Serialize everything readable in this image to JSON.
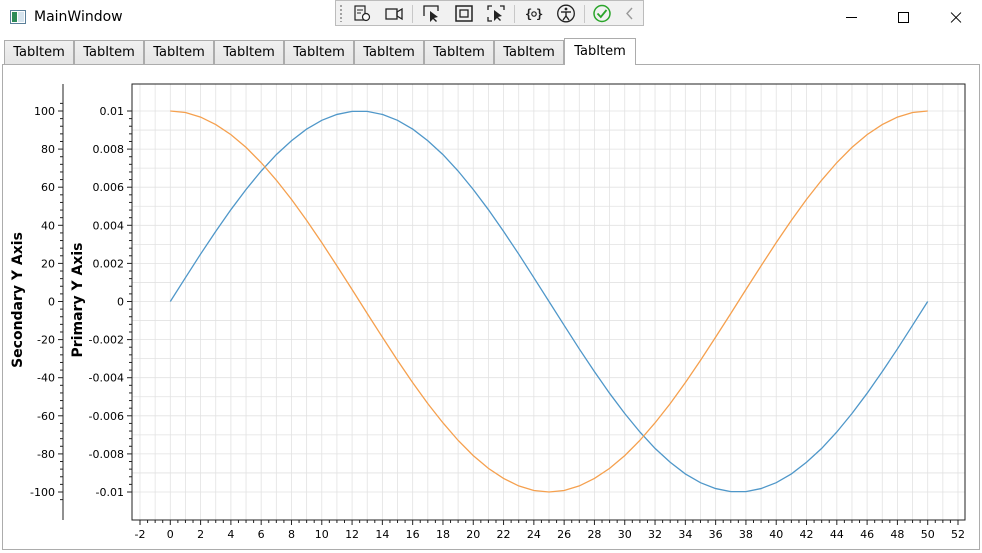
{
  "window": {
    "title": "MainWindow"
  },
  "tabs": [
    "TabItem",
    "TabItem",
    "TabItem",
    "TabItem",
    "TabItem",
    "TabItem",
    "TabItem",
    "TabItem",
    "TabItem"
  ],
  "selected_tab": 8,
  "colors": {
    "series_blue": "#4f97c9",
    "series_orange": "#f5a04e",
    "grid": "#e2e2e2",
    "check_green": "#2aa52a"
  },
  "debug_toolbar": {
    "icons": [
      "live-visual-tree-icon",
      "record-icon",
      "select-element-icon",
      "display-layout-adorners-icon",
      "track-focus-icon",
      "binding-failures-icon",
      "accessibility-icon",
      "checkmark-icon",
      "collapse-icon"
    ]
  },
  "chart_data": {
    "type": "line",
    "xlabel": "",
    "ylabel": "Primary Y Axis",
    "y2label": "Secondary Y Axis",
    "xlim": [
      -2,
      52
    ],
    "ylim": [
      -0.01,
      0.01
    ],
    "y2lim": [
      -100,
      100
    ],
    "grid": true,
    "x_ticks": [
      "-2",
      "0",
      "2",
      "4",
      "6",
      "8",
      "10",
      "12",
      "14",
      "16",
      "18",
      "20",
      "22",
      "24",
      "26",
      "28",
      "30",
      "32",
      "34",
      "36",
      "38",
      "40",
      "42",
      "44",
      "46",
      "48",
      "50",
      "52"
    ],
    "y_ticks": [
      "0.01",
      "0.008",
      "0.006",
      "0.004",
      "0.002",
      "0",
      "-0.002",
      "-0.004",
      "-0.006",
      "-0.008",
      "-0.01"
    ],
    "y2_ticks": [
      "100",
      "80",
      "60",
      "40",
      "20",
      "0",
      "-20",
      "-40",
      "-60",
      "-80",
      "-100"
    ],
    "series": [
      {
        "axis": "primary",
        "color": "#4f97c9",
        "x": [
          0,
          1,
          2,
          3,
          4,
          5,
          6,
          7,
          8,
          9,
          10,
          11,
          12,
          13,
          14,
          15,
          16,
          17,
          18,
          19,
          20,
          21,
          22,
          23,
          24,
          25,
          26,
          27,
          28,
          29,
          30,
          31,
          32,
          33,
          34,
          35,
          36,
          37,
          38,
          39,
          40,
          41,
          42,
          43,
          44,
          45,
          46,
          47,
          48,
          49,
          50
        ],
        "y": [
          0,
          0.00125,
          0.00249,
          0.00368,
          0.00482,
          0.00588,
          0.00685,
          0.00771,
          0.00844,
          0.00905,
          0.00951,
          0.00982,
          0.00998,
          0.00998,
          0.00982,
          0.00951,
          0.00905,
          0.00844,
          0.00771,
          0.00685,
          0.00588,
          0.00482,
          0.00368,
          0.00249,
          0.00125,
          0,
          -0.00125,
          -0.00249,
          -0.00368,
          -0.00482,
          -0.00588,
          -0.00685,
          -0.00771,
          -0.00844,
          -0.00905,
          -0.00951,
          -0.00982,
          -0.00998,
          -0.00998,
          -0.00982,
          -0.00951,
          -0.00905,
          -0.00844,
          -0.00771,
          -0.00685,
          -0.00588,
          -0.00482,
          -0.00368,
          -0.00249,
          -0.00125,
          0
        ]
      },
      {
        "axis": "secondary",
        "color": "#f5a04e",
        "x": [
          0,
          1,
          2,
          3,
          4,
          5,
          6,
          7,
          8,
          9,
          10,
          11,
          12,
          13,
          14,
          15,
          16,
          17,
          18,
          19,
          20,
          21,
          22,
          23,
          24,
          25,
          26,
          27,
          28,
          29,
          30,
          31,
          32,
          33,
          34,
          35,
          36,
          37,
          38,
          39,
          40,
          41,
          42,
          43,
          44,
          45,
          46,
          47,
          48,
          49,
          50
        ],
        "y": [
          100,
          99.2,
          96.8,
          92.9,
          87.6,
          80.9,
          72.9,
          63.7,
          53.6,
          42.6,
          30.9,
          18.7,
          6.3,
          -6.3,
          -18.7,
          -30.9,
          -42.6,
          -53.6,
          -63.7,
          -72.9,
          -80.9,
          -87.6,
          -92.9,
          -96.8,
          -99.2,
          -100,
          -99.2,
          -96.8,
          -92.9,
          -87.6,
          -80.9,
          -72.9,
          -63.7,
          -53.6,
          -42.6,
          -30.9,
          -18.7,
          -6.3,
          6.3,
          18.7,
          30.9,
          42.6,
          53.6,
          63.7,
          72.9,
          80.9,
          87.6,
          92.9,
          96.8,
          99.2,
          100
        ]
      }
    ]
  }
}
